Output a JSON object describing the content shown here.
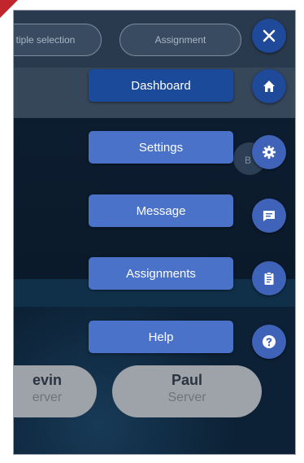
{
  "top_pills": {
    "multiple_selection": "tiple selection",
    "assignment": "Assignment"
  },
  "side_partial_letter": "B",
  "menu": [
    {
      "label": "Dashboard",
      "active": true,
      "icon": "home-icon"
    },
    {
      "label": "Settings",
      "active": false,
      "icon": "gear-icon"
    },
    {
      "label": "Message",
      "active": false,
      "icon": "message-icon"
    },
    {
      "label": "Assignments",
      "active": false,
      "icon": "clipboard-icon"
    },
    {
      "label": "Help",
      "active": false,
      "icon": "help-icon"
    }
  ],
  "close_icon": "close-icon",
  "servers": [
    {
      "name": "evin",
      "role": "erver"
    },
    {
      "name": "Paul",
      "role": "Server"
    }
  ],
  "colors": {
    "menu_button": "#4a72c8",
    "menu_button_active": "#1c4a9a",
    "fab": "#3f63b9",
    "background": "#0e2134",
    "server_pill": "#9ea3a9"
  }
}
